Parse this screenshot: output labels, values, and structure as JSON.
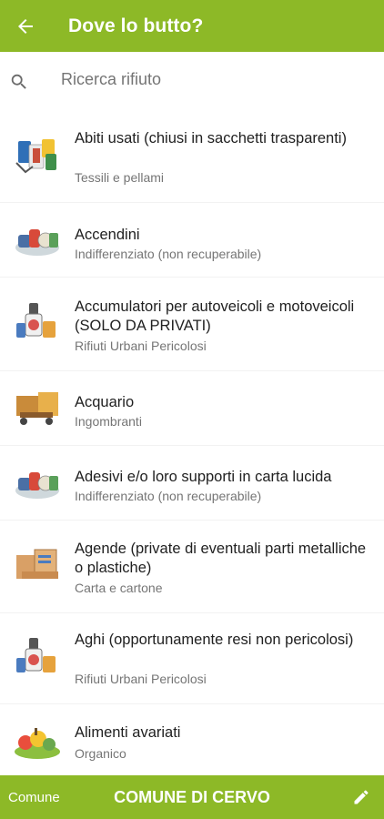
{
  "appbar": {
    "title": "Dove lo butto?",
    "back_icon": "arrow-back-icon",
    "color": "#8DB927"
  },
  "search": {
    "placeholder": "Ricerca rifiuto",
    "icon": "search-icon"
  },
  "items": [
    {
      "name": "Abiti usati (chiusi in sacchetti trasparenti)",
      "category": "Tessili e pellami",
      "icon": "textiles-icon"
    },
    {
      "name": "Accendini",
      "category": "Indifferenziato (non recuperabile)",
      "icon": "unsorted-waste-icon"
    },
    {
      "name": "Accumulatori per autoveicoli e motoveicoli (SOLO DA PRIVATI)",
      "category": "Rifiuti Urbani Pericolosi",
      "icon": "hazardous-waste-icon"
    },
    {
      "name": "Acquario",
      "category": "Ingombranti",
      "icon": "bulky-waste-icon"
    },
    {
      "name": "Adesivi e/o loro supporti in carta lucida",
      "category": "Indifferenziato (non recuperabile)",
      "icon": "unsorted-waste-icon"
    },
    {
      "name": "Agende (private di eventuali parti metalliche o plastiche)",
      "category": "Carta e cartone",
      "icon": "paper-cardboard-icon"
    },
    {
      "name": "Aghi (opportunamente resi non pericolosi)",
      "category": "Rifiuti Urbani Pericolosi",
      "icon": "hazardous-waste-icon"
    },
    {
      "name": "Alimenti avariati",
      "category": "Organico",
      "icon": "organic-waste-icon"
    }
  ],
  "bottombar": {
    "comune_label": "Comune",
    "city": "COMUNE DI CERVO",
    "edit_icon": "pencil-icon"
  }
}
